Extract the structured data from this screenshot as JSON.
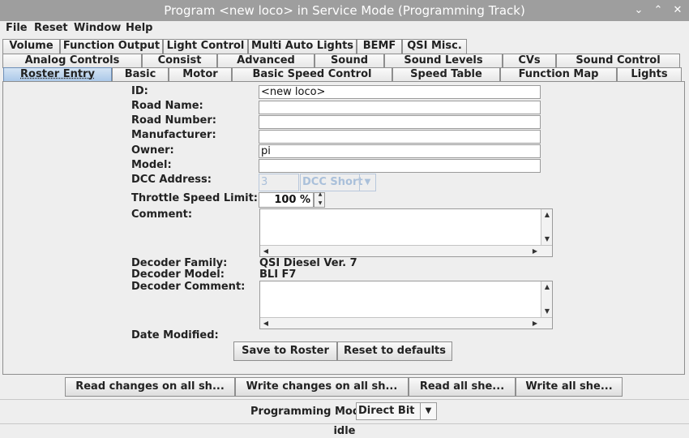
{
  "window": {
    "title": "Program <new loco> in Service Mode (Programming Track)",
    "minimize_glyph": "⌄",
    "maximize_glyph": "⌃",
    "close_glyph": "✕"
  },
  "menu": [
    "File",
    "Reset",
    "Window",
    "Help"
  ],
  "tabs": {
    "row1": [
      "Volume",
      "Function Output",
      "Light Control",
      "Multi Auto Lights",
      "BEMF",
      "QSI Misc."
    ],
    "row2": [
      "Analog Controls",
      "Consist",
      "Advanced",
      "Sound",
      "Sound Levels",
      "CVs",
      "Sound Control"
    ],
    "row3": [
      "Roster Entry",
      "Basic",
      "Motor",
      "Basic Speed Control",
      "Speed Table",
      "Function Map",
      "Lights"
    ],
    "active": "Roster Entry"
  },
  "roster": {
    "id_label": "ID:",
    "id_value": "<new loco>",
    "road_name_label": "Road Name:",
    "road_name_value": "",
    "road_number_label": "Road Number:",
    "road_number_value": "",
    "manufacturer_label": "Manufacturer:",
    "manufacturer_value": "",
    "owner_label": "Owner:",
    "owner_value": "pi",
    "model_label": "Model:",
    "model_value": "",
    "dcc_address_label": "DCC Address:",
    "dcc_address_value": "3",
    "dcc_address_type": "DCC Short",
    "throttle_label": "Throttle Speed Limit:",
    "throttle_value": "100 %",
    "comment_label": "Comment:",
    "decoder_family_label": "Decoder Family:",
    "decoder_family_value": "QSI Diesel Ver. 7",
    "decoder_model_label": "Decoder Model:",
    "decoder_model_value": "BLI F7",
    "decoder_comment_label": "Decoder Comment:",
    "date_modified_label": "Date Modified:",
    "save_button": "Save to Roster",
    "reset_button": "Reset to defaults"
  },
  "bottom": {
    "read_changes": "Read changes on all sh...",
    "write_changes": "Write changes on all sh...",
    "read_all": "Read all she...",
    "write_all": "Write all she...",
    "programming_mode_label": "Programming Mode",
    "programming_mode_value": "Direct Bit",
    "status": "idle"
  },
  "icons": {
    "scroll_up": "▲",
    "scroll_down": "▼",
    "scroll_left": "◀",
    "scroll_right": "▶",
    "spin_up": "▲",
    "spin_down": "▼",
    "combo_down": "▼"
  }
}
